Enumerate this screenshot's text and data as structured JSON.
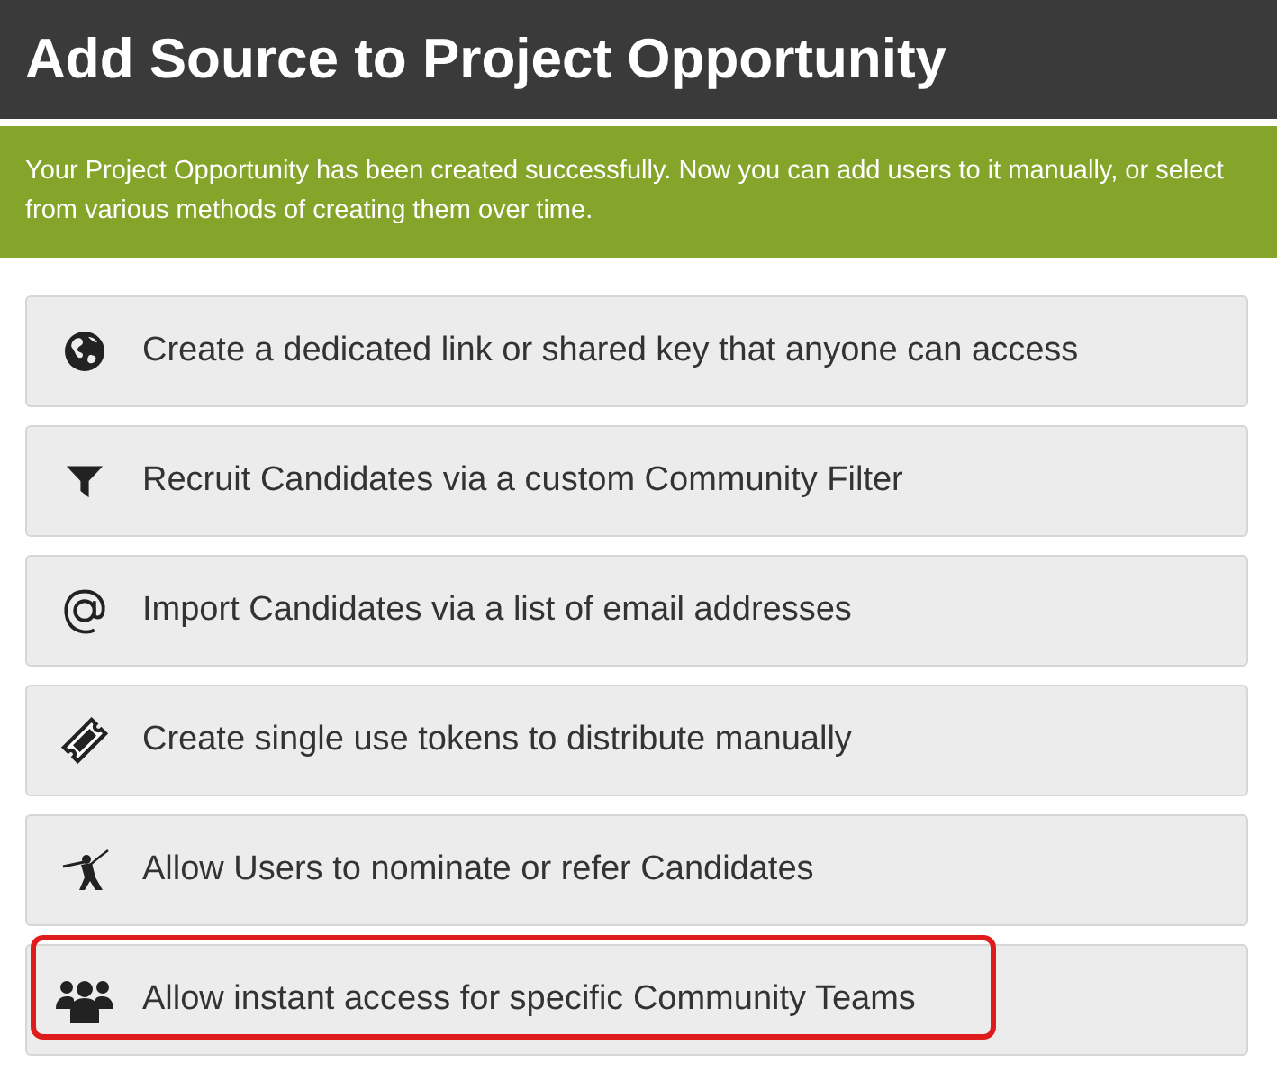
{
  "header": {
    "title": "Add Source to Project Opportunity"
  },
  "notice": {
    "text": "Your Project Opportunity has been created successfully. Now you can add users to it manually, or select from various methods of creating them over time."
  },
  "options": [
    {
      "label": "Create a dedicated link or shared key that anyone can access",
      "highlighted": false
    },
    {
      "label": "Recruit Candidates via a custom Community Filter",
      "highlighted": false
    },
    {
      "label": "Import Candidates via a list of email addresses",
      "highlighted": false
    },
    {
      "label": "Create single use tokens to distribute manually",
      "highlighted": false
    },
    {
      "label": "Allow Users to nominate or refer Candidates",
      "highlighted": false
    },
    {
      "label": "Allow instant access for specific Community Teams",
      "highlighted": true
    }
  ]
}
